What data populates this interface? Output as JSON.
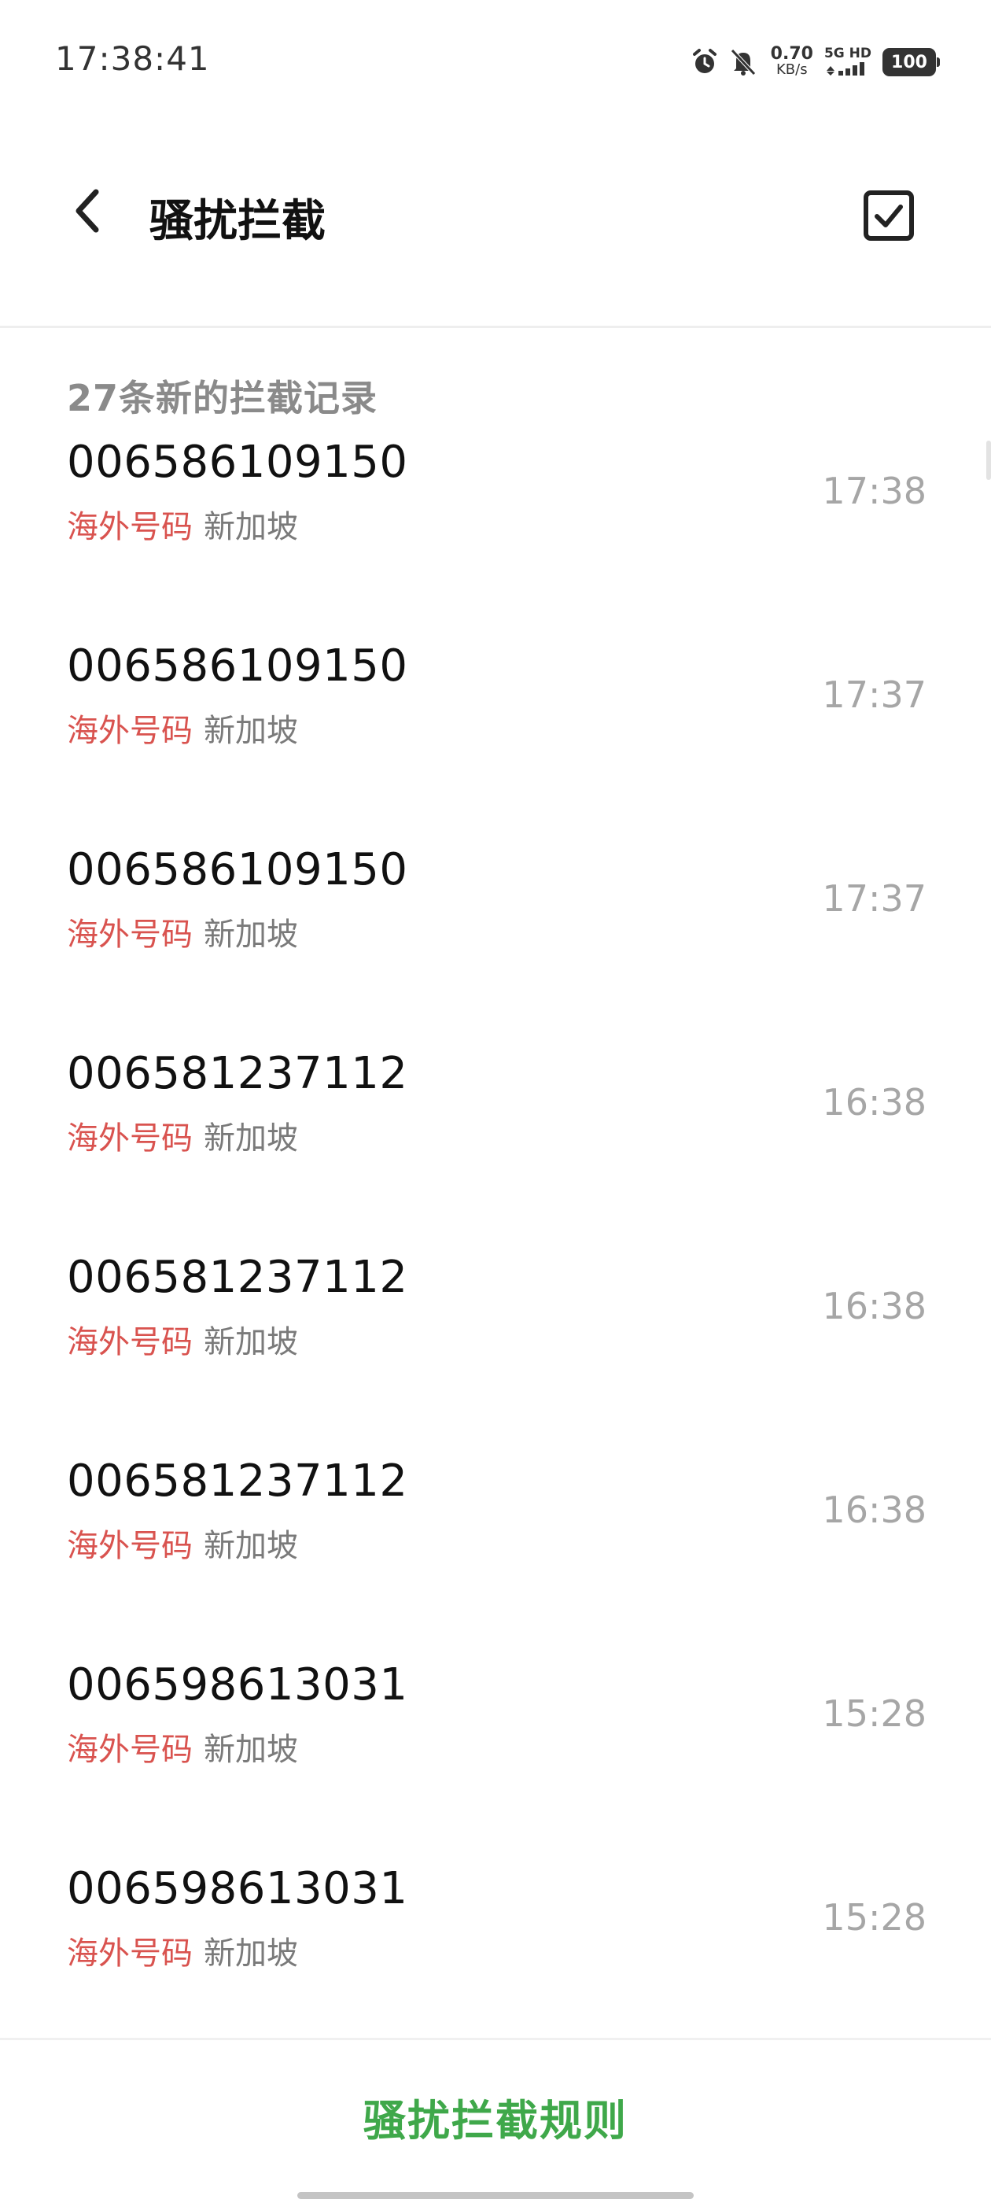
{
  "status_bar": {
    "time": "17:38:41",
    "speed_value": "0.70",
    "speed_unit": "KB/s",
    "network": "5G HD",
    "battery": "100",
    "icons": [
      "alarm-icon",
      "mute-bell-icon",
      "signal-icon"
    ]
  },
  "header": {
    "title": "骚扰拦截",
    "back_icon": "chevron-left-icon",
    "select_icon": "checkbox-icon"
  },
  "section": {
    "title": "27条新的拦截记录"
  },
  "calls": [
    {
      "number": "006586109150",
      "tag": "海外号码",
      "location": "新加坡",
      "time": "17:38"
    },
    {
      "number": "006586109150",
      "tag": "海外号码",
      "location": "新加坡",
      "time": "17:37"
    },
    {
      "number": "006586109150",
      "tag": "海外号码",
      "location": "新加坡",
      "time": "17:37"
    },
    {
      "number": "006581237112",
      "tag": "海外号码",
      "location": "新加坡",
      "time": "16:38"
    },
    {
      "number": "006581237112",
      "tag": "海外号码",
      "location": "新加坡",
      "time": "16:38"
    },
    {
      "number": "006581237112",
      "tag": "海外号码",
      "location": "新加坡",
      "time": "16:38"
    },
    {
      "number": "006598613031",
      "tag": "海外号码",
      "location": "新加坡",
      "time": "15:28"
    },
    {
      "number": "006598613031",
      "tag": "海外号码",
      "location": "新加坡",
      "time": "15:28"
    }
  ],
  "footer": {
    "rules_label": "骚扰拦截规则"
  },
  "colors": {
    "tag": "#d9534f",
    "accent": "#3fa84a",
    "muted": "#a6a6a6"
  }
}
